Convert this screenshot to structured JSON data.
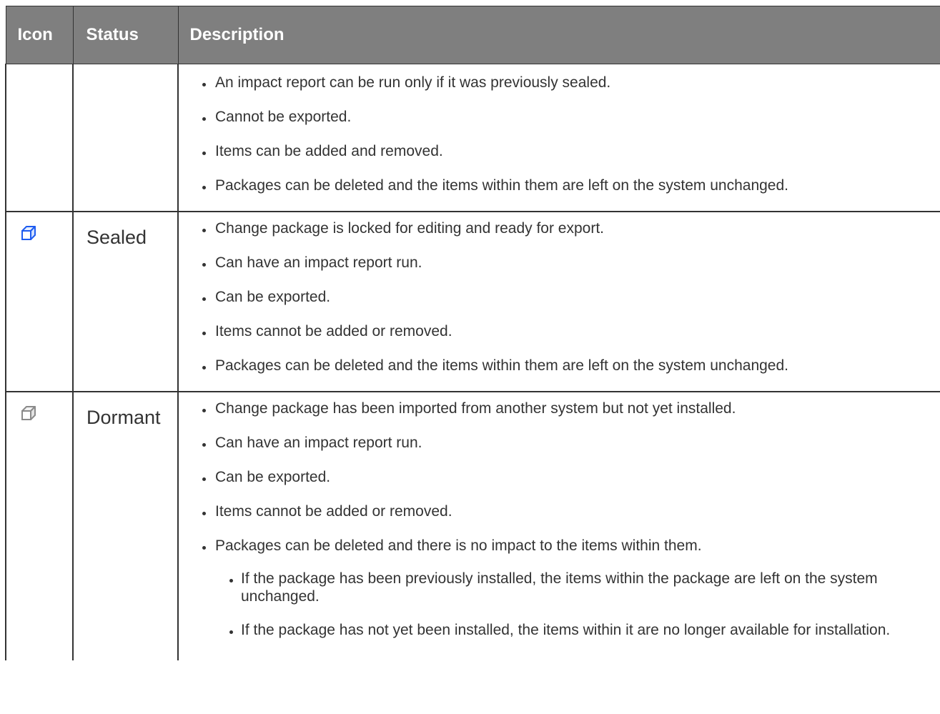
{
  "table": {
    "headers": {
      "icon": "Icon",
      "status": "Status",
      "description": "Description"
    },
    "rows": [
      {
        "icon": "",
        "status": "",
        "items": [
          "An impact report can be run only if it was previously sealed.",
          "Cannot be exported.",
          "Items can be added and removed.",
          "Packages can be deleted and the items within them are left on the system unchanged."
        ]
      },
      {
        "icon": "blue-package-cube-icon",
        "icon_color": "#1e5cf0",
        "status": "Sealed",
        "items": [
          "Change package is locked for editing and ready for export.",
          "Can have an impact report run.",
          "Can be exported.",
          "Items cannot be added or removed.",
          "Packages can be deleted and the items within them are left on the system unchanged."
        ]
      },
      {
        "icon": "gray-package-cube-icon",
        "icon_color": "#8a8a8a",
        "status": "Dormant",
        "items": [
          "Change package has been imported from another system but not yet installed.",
          "Can have an impact report run.",
          "Can be exported.",
          "Items cannot be added or removed.",
          "Packages can be deleted and there is no impact to the items within them."
        ],
        "sub_items": [
          "If the package has been previously installed, the items within the package are left on the system unchanged.",
          "If the package has not yet been installed, the items within it are no longer available for installation."
        ]
      }
    ]
  },
  "colors": {
    "header_bg": "#7f7f7f",
    "header_text": "#ffffff",
    "border": "#333333",
    "body_text": "#333333"
  }
}
